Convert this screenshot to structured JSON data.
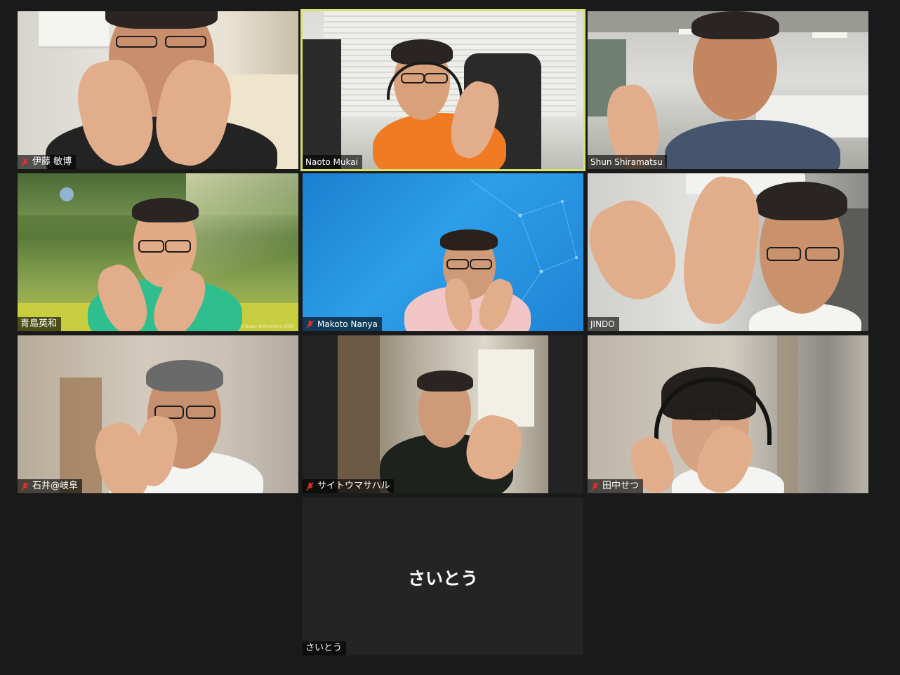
{
  "participants": [
    {
      "name": "伊藤 敏博",
      "muted": true
    },
    {
      "name": "Naoto Mukai",
      "muted": false,
      "active_speaker": true
    },
    {
      "name": "Shun Shiramatsu",
      "muted": false
    },
    {
      "name": "青島英和",
      "muted": false,
      "background_credit": "©Gusty Animations 2020"
    },
    {
      "name": "Makoto Nanya",
      "muted": true
    },
    {
      "name": "JINDO",
      "muted": false
    },
    {
      "name": "石井@岐阜",
      "muted": true
    },
    {
      "name": "サイトウマサハル",
      "muted": true
    },
    {
      "name": "田中せつ",
      "muted": true
    },
    {
      "name": "さいとう",
      "muted": false,
      "video_off": true,
      "display_name": "さいとう"
    }
  ],
  "colors": {
    "background": "#1a1a1a",
    "active_speaker_border": "#d7e36b",
    "muted_icon": "#e0302e"
  }
}
